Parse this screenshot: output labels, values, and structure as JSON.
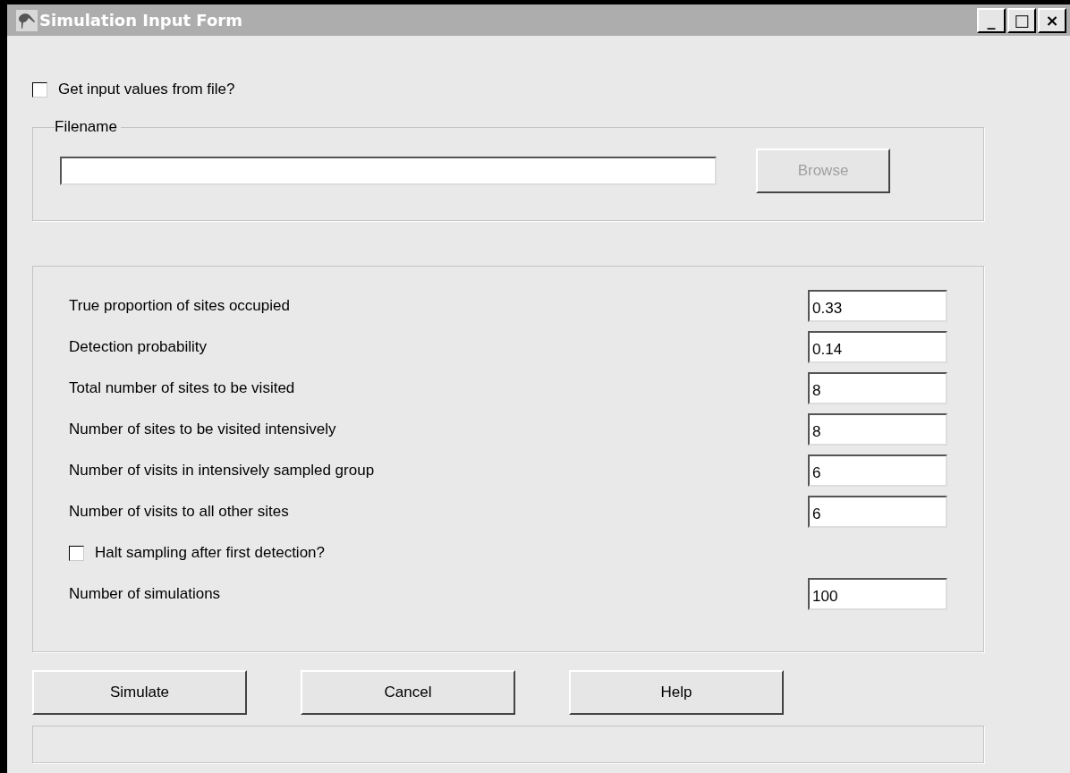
{
  "window": {
    "title": "Simulation Input Form",
    "controls": [
      "_",
      "□",
      "×"
    ]
  },
  "file_checkbox": {
    "label": "Get input values from file?",
    "checked": false
  },
  "filename_group": {
    "title": "Filename",
    "browse": {
      "label": "Browse",
      "disabled": true
    }
  },
  "rows": [
    {
      "kind": "field",
      "label": "True proportion of sites occupied",
      "value": "0.33"
    },
    {
      "kind": "field",
      "label": "Detection probability",
      "value": "0.14"
    },
    {
      "kind": "field",
      "label": "Total number of sites to be visited",
      "value": "8"
    },
    {
      "kind": "field",
      "label": "Number of sites to be visited intensively",
      "value": "8"
    },
    {
      "kind": "field",
      "label": "Number of visits in intensively sampled group",
      "value": "6"
    },
    {
      "kind": "field",
      "label": "Number of visits to all other sites",
      "value": "6"
    },
    {
      "kind": "checkbox",
      "label": "Halt sampling after first detection?",
      "checked": false
    },
    {
      "kind": "field",
      "label": "Number of simulations",
      "value": "100"
    }
  ],
  "buttons": [
    "Simulate",
    "Cancel",
    "Help"
  ]
}
